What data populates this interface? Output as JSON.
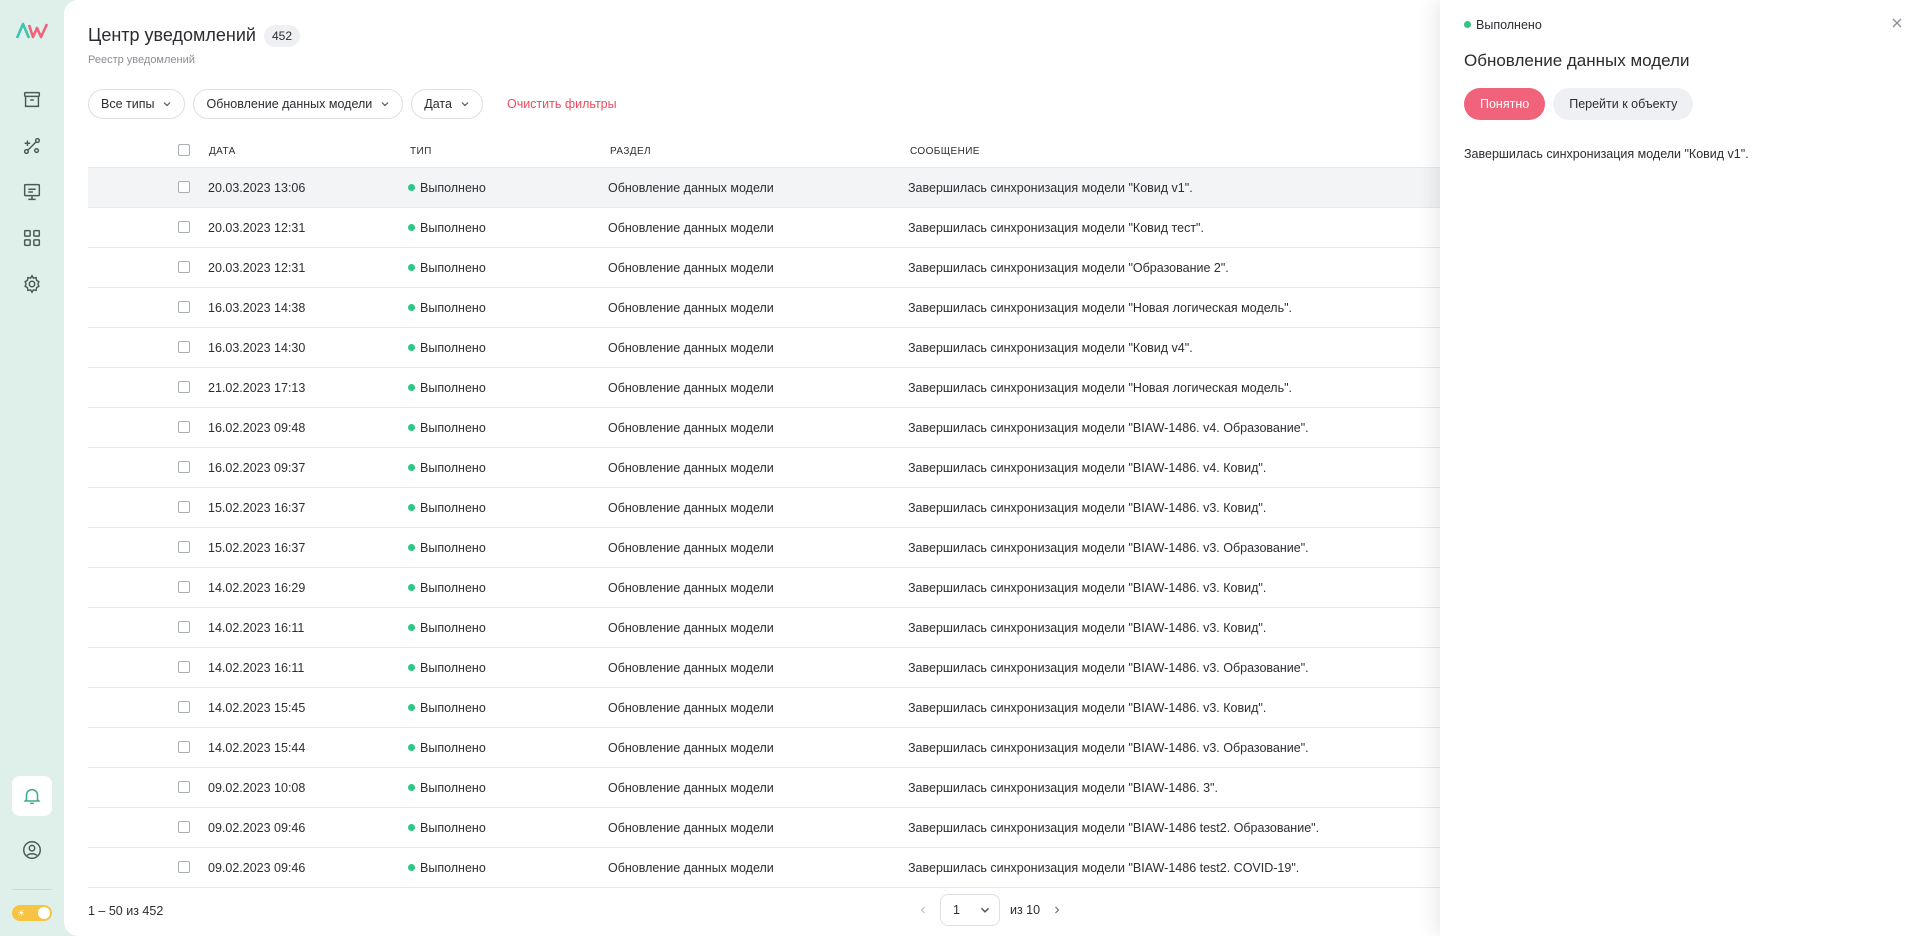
{
  "sidebar": {
    "logo": "AW",
    "items": [
      {
        "icon": "archive-icon",
        "active": false
      },
      {
        "icon": "model-icon",
        "active": false
      },
      {
        "icon": "presentation-icon",
        "active": false
      },
      {
        "icon": "grid-icon",
        "active": false
      },
      {
        "icon": "gear-icon",
        "active": false
      },
      {
        "icon": "bell-icon",
        "active": true
      },
      {
        "icon": "user-icon",
        "active": false
      }
    ],
    "theme_toggle": "sun-icon"
  },
  "header": {
    "title": "Центр уведомлений",
    "count": "452",
    "subtitle": "Реестр уведомлений"
  },
  "filters": {
    "type": "Все типы",
    "section": "Обновление данных модели",
    "date": "Дата",
    "clear": "Очистить фильтры"
  },
  "table": {
    "columns": {
      "date": "Дата",
      "type": "Тип",
      "section": "Раздел",
      "message": "Сообщение"
    },
    "rows": [
      {
        "date": "20.03.2023 13:06",
        "type": "Выполнено",
        "section": "Обновление данных модели",
        "message": "Завершилась синхронизация модели \"Ковид v1\"."
      },
      {
        "date": "20.03.2023 12:31",
        "type": "Выполнено",
        "section": "Обновление данных модели",
        "message": "Завершилась синхронизация модели \"Ковид тест\"."
      },
      {
        "date": "20.03.2023 12:31",
        "type": "Выполнено",
        "section": "Обновление данных модели",
        "message": "Завершилась синхронизация модели \"Образование 2\"."
      },
      {
        "date": "16.03.2023 14:38",
        "type": "Выполнено",
        "section": "Обновление данных модели",
        "message": "Завершилась синхронизация модели \"Новая логическая модель\"."
      },
      {
        "date": "16.03.2023 14:30",
        "type": "Выполнено",
        "section": "Обновление данных модели",
        "message": "Завершилась синхронизация модели \"Ковид v4\"."
      },
      {
        "date": "21.02.2023 17:13",
        "type": "Выполнено",
        "section": "Обновление данных модели",
        "message": "Завершилась синхронизация модели \"Новая логическая модель\"."
      },
      {
        "date": "16.02.2023 09:48",
        "type": "Выполнено",
        "section": "Обновление данных модели",
        "message": "Завершилась синхронизация модели \"BIAW-1486. v4. Образование\"."
      },
      {
        "date": "16.02.2023 09:37",
        "type": "Выполнено",
        "section": "Обновление данных модели",
        "message": "Завершилась синхронизация модели \"BIAW-1486. v4. Ковид\"."
      },
      {
        "date": "15.02.2023 16:37",
        "type": "Выполнено",
        "section": "Обновление данных модели",
        "message": "Завершилась синхронизация модели \"BIAW-1486. v3. Ковид\"."
      },
      {
        "date": "15.02.2023 16:37",
        "type": "Выполнено",
        "section": "Обновление данных модели",
        "message": "Завершилась синхронизация модели \"BIAW-1486. v3. Образование\"."
      },
      {
        "date": "14.02.2023 16:29",
        "type": "Выполнено",
        "section": "Обновление данных модели",
        "message": "Завершилась синхронизация модели \"BIAW-1486. v3. Ковид\"."
      },
      {
        "date": "14.02.2023 16:11",
        "type": "Выполнено",
        "section": "Обновление данных модели",
        "message": "Завершилась синхронизация модели \"BIAW-1486. v3. Ковид\"."
      },
      {
        "date": "14.02.2023 16:11",
        "type": "Выполнено",
        "section": "Обновление данных модели",
        "message": "Завершилась синхронизация модели \"BIAW-1486. v3. Образование\"."
      },
      {
        "date": "14.02.2023 15:45",
        "type": "Выполнено",
        "section": "Обновление данных модели",
        "message": "Завершилась синхронизация модели \"BIAW-1486. v3. Ковид\"."
      },
      {
        "date": "14.02.2023 15:44",
        "type": "Выполнено",
        "section": "Обновление данных модели",
        "message": "Завершилась синхронизация модели \"BIAW-1486. v3. Образование\"."
      },
      {
        "date": "09.02.2023 10:08",
        "type": "Выполнено",
        "section": "Обновление данных модели",
        "message": "Завершилась синхронизация модели \"BIAW-1486. 3\"."
      },
      {
        "date": "09.02.2023 09:46",
        "type": "Выполнено",
        "section": "Обновление данных модели",
        "message": "Завершилась синхронизация модели \"BIAW-1486 test2. Образование\"."
      },
      {
        "date": "09.02.2023 09:46",
        "type": "Выполнено",
        "section": "Обновление данных модели",
        "message": "Завершилась синхронизация модели \"BIAW-1486 test2. COVID-19\"."
      }
    ]
  },
  "pagination": {
    "range": "1 – 50 из 452",
    "page": "1",
    "of": "из 10"
  },
  "drawer": {
    "status": "Выполнено",
    "title": "Обновление данных модели",
    "primary_button": "Понятно",
    "secondary_button": "Перейти к объекту",
    "message": "Завершилась синхронизация модели \"Ковид v1\"."
  },
  "colors": {
    "accent": "#f1637b",
    "success": "#2fc488",
    "sidebar_bg": "#dff0ea",
    "danger_link": "#ef4a60"
  }
}
